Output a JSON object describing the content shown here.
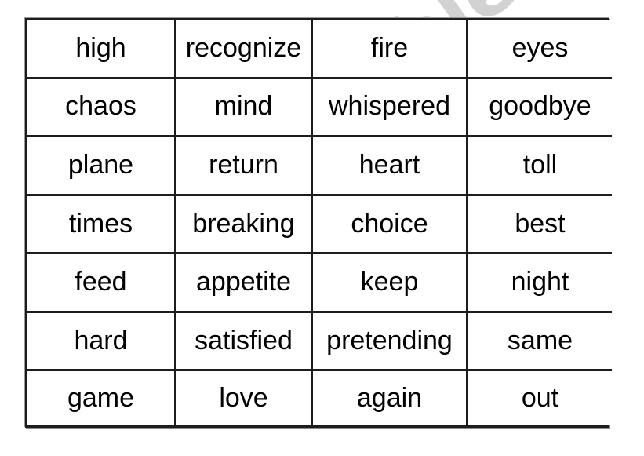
{
  "document": {
    "type": "word-card-worksheet",
    "columns": 4,
    "rows": 7,
    "text_color": "#000000",
    "border_color": "#1d1d1d",
    "background_color": "#ffffff"
  },
  "watermark": {
    "text": "eslprintables.com",
    "color": "#d2d2d2",
    "rotation_degrees": -36
  },
  "table": {
    "rows": [
      [
        {
          "word": "high",
          "size": "normal"
        },
        {
          "word": "recognize",
          "size": "small"
        },
        {
          "word": "fire",
          "size": "normal"
        },
        {
          "word": "eyes",
          "size": "normal"
        }
      ],
      [
        {
          "word": "chaos",
          "size": "normal"
        },
        {
          "word": "mind",
          "size": "normal"
        },
        {
          "word": "whispered",
          "size": "small"
        },
        {
          "word": "goodbye",
          "size": "normal"
        }
      ],
      [
        {
          "word": "plane",
          "size": "normal"
        },
        {
          "word": "return",
          "size": "normal"
        },
        {
          "word": "heart",
          "size": "normal"
        },
        {
          "word": "toll",
          "size": "normal"
        }
      ],
      [
        {
          "word": "times",
          "size": "normal"
        },
        {
          "word": "breaking",
          "size": "medium"
        },
        {
          "word": "choice",
          "size": "normal"
        },
        {
          "word": "best",
          "size": "normal"
        }
      ],
      [
        {
          "word": "feed",
          "size": "normal"
        },
        {
          "word": "appetite",
          "size": "medium"
        },
        {
          "word": "keep",
          "size": "normal"
        },
        {
          "word": "night",
          "size": "normal"
        }
      ],
      [
        {
          "word": "hard",
          "size": "normal"
        },
        {
          "word": "satisfied",
          "size": "medium"
        },
        {
          "word": "pretending",
          "size": "small"
        },
        {
          "word": "same",
          "size": "normal"
        }
      ],
      [
        {
          "word": "game",
          "size": "normal"
        },
        {
          "word": "love",
          "size": "normal"
        },
        {
          "word": "again",
          "size": "normal"
        },
        {
          "word": "out",
          "size": "normal"
        }
      ]
    ]
  }
}
